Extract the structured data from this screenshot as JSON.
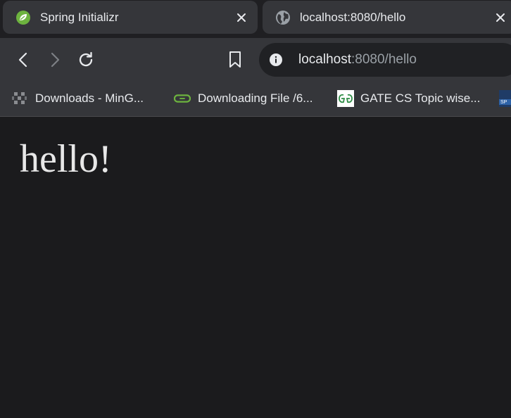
{
  "tabs": [
    {
      "title": "Spring Initializr",
      "favicon": "spring-leaf-icon",
      "active": false
    },
    {
      "title": "localhost:8080/hello",
      "favicon": "globe-icon",
      "active": true
    }
  ],
  "toolbar": {
    "url_host": "localhost",
    "url_rest": ":8080/hello"
  },
  "bookmarks": [
    {
      "label": "Downloads - MinG...",
      "icon": "sourceforge-grid-icon"
    },
    {
      "label": "Downloading File /6...",
      "icon": "download-link-icon"
    },
    {
      "label": "GATE CS Topic wise...",
      "icon": "geeksforgeeks-icon"
    },
    {
      "label": "",
      "icon": "sap-icon"
    }
  ],
  "page": {
    "heading": "hello!"
  },
  "colors": {
    "spring_green": "#6db33f",
    "tab_bg": "#35363a",
    "page_bg": "#1b1b1d",
    "text": "#e8eaed"
  }
}
